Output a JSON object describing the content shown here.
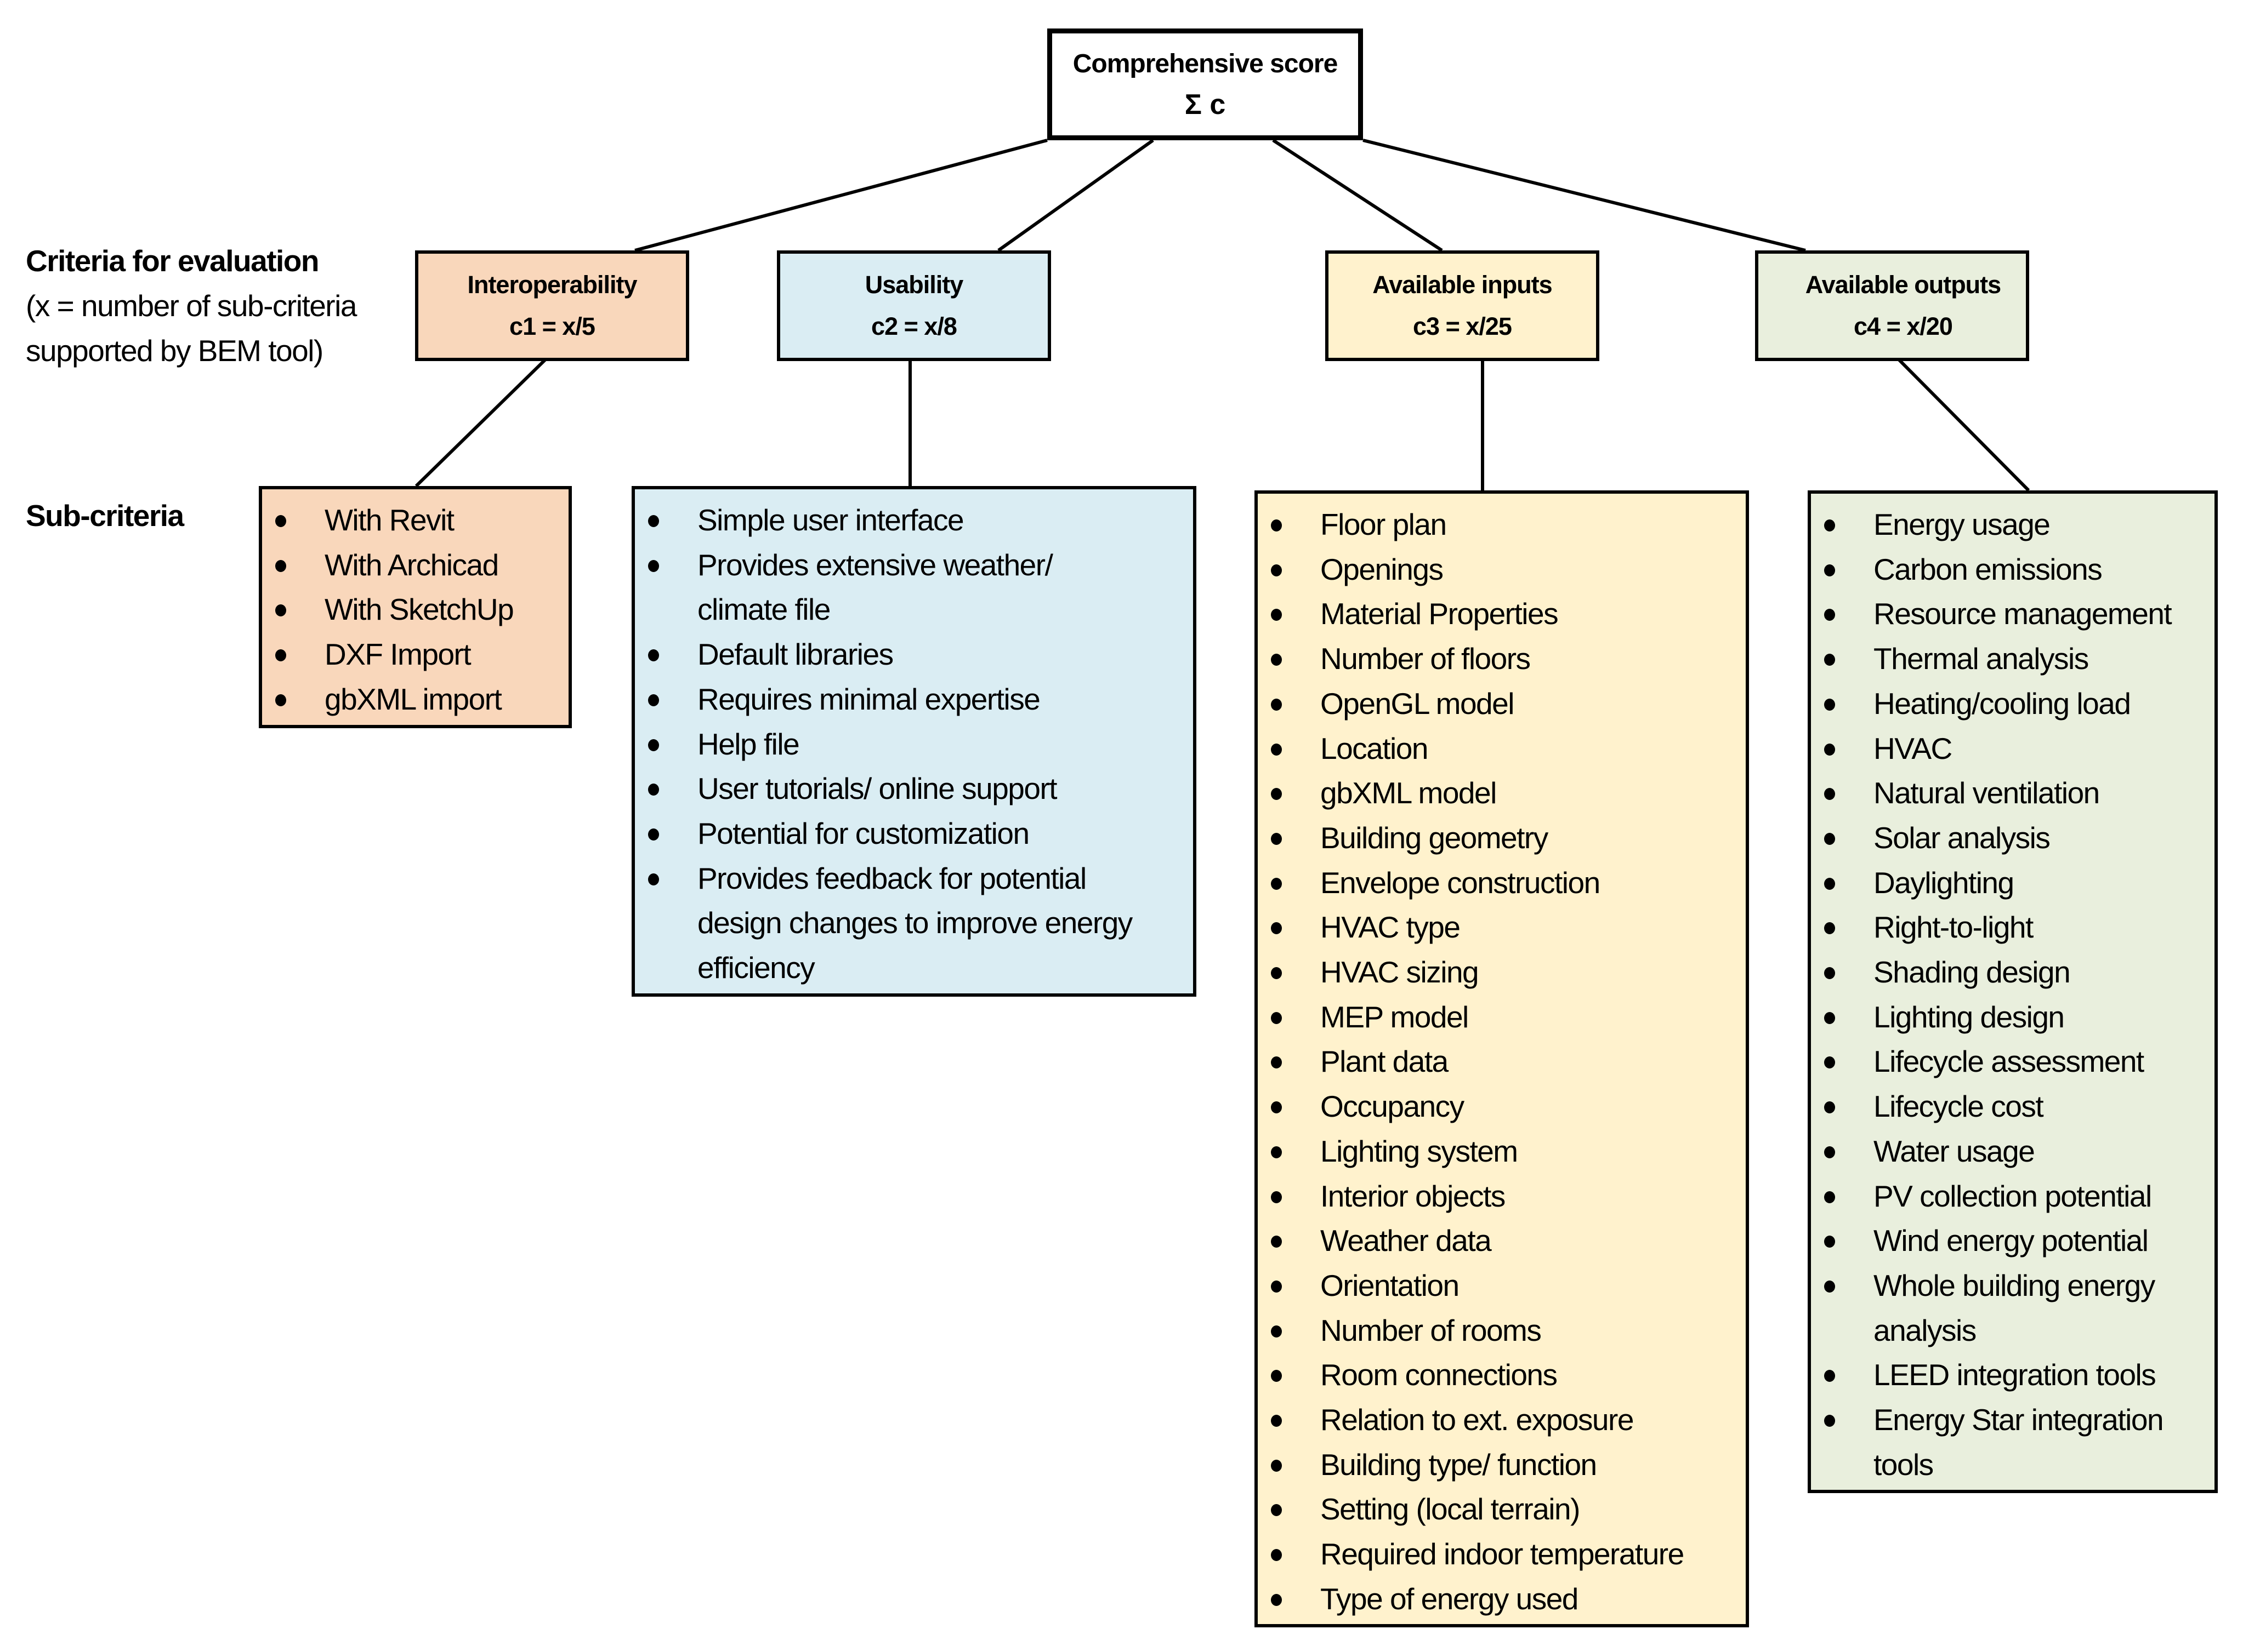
{
  "root": {
    "title": "Comprehensive score",
    "formula": "Σ c"
  },
  "side_labels": {
    "criteria_heading": "Criteria for evaluation",
    "criteria_note_line1": "(x = number of sub-criteria",
    "criteria_note_line2": "supported by BEM tool)",
    "subcriteria_heading": "Sub-criteria"
  },
  "colors": {
    "interoperability": "#F9D7BB",
    "usability": "#DAEDF3",
    "inputs": "#FFF2CD",
    "outputs": "#E9EFDD"
  },
  "criteria": [
    {
      "name": "Interoperability",
      "formula": "c1 = x/5",
      "sub_criteria": [
        "With Revit",
        "With Archicad",
        "With SketchUp",
        "DXF Import",
        "gbXML import"
      ]
    },
    {
      "name": "Usability",
      "formula": "c2 = x/8",
      "sub_criteria": [
        "Simple user interface",
        "Provides extensive weather/\nclimate file",
        "Default libraries",
        "Requires minimal expertise",
        "Help file",
        "User tutorials/ online support",
        "Potential for customization",
        "Provides feedback for potential\ndesign changes to improve energy\nefficiency"
      ]
    },
    {
      "name": "Available inputs",
      "formula": "c3 = x/25",
      "sub_criteria": [
        "Floor plan",
        "Openings",
        "Material Properties",
        "Number of floors",
        "OpenGL model",
        "Location",
        "gbXML model",
        "Building geometry",
        "Envelope construction",
        "HVAC type",
        "HVAC sizing",
        "MEP model",
        "Plant data",
        "Occupancy",
        "Lighting system",
        "Interior objects",
        "Weather data",
        "Orientation",
        "Number of rooms",
        "Room connections",
        "Relation to ext. exposure",
        "Building type/ function",
        "Setting (local terrain)",
        "Required indoor temperature",
        "Type of energy used"
      ]
    },
    {
      "name": "Available outputs",
      "formula": "c4 = x/20",
      "sub_criteria": [
        "Energy usage",
        "Carbon emissions",
        "Resource management",
        "Thermal analysis",
        "Heating/cooling load",
        "HVAC",
        "Natural ventilation",
        "Solar analysis",
        "Daylighting",
        "Right-to-light",
        "Shading design",
        "Lighting design",
        "Lifecycle assessment",
        "Lifecycle cost",
        "Water usage",
        "PV collection potential",
        "Wind energy potential",
        "Whole building energy\nanalysis",
        "LEED integration tools",
        "Energy Star integration\ntools"
      ]
    }
  ]
}
